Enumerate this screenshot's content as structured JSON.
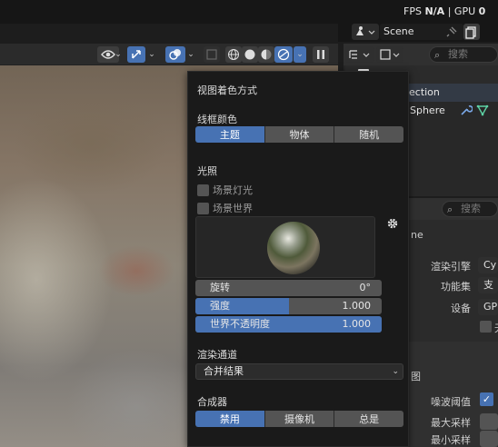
{
  "topbar": {
    "fps_label": "FPS",
    "fps_value": "N/A",
    "separator": "|",
    "gpu_label": "GPU",
    "gpu_value": "0"
  },
  "scene": {
    "name": "Scene"
  },
  "outliner": {
    "search_placeholder": "搜索",
    "collection_label": "ection",
    "object_label": "Sphere"
  },
  "popover": {
    "title": "视图着色方式",
    "wire_color": {
      "label": "线框颜色",
      "options": [
        "主题",
        "物体",
        "随机"
      ],
      "selected": 0
    },
    "lighting": {
      "label": "光照",
      "scene_lights_label": "场景灯光",
      "scene_world_label": "场景世界",
      "rotation": {
        "label": "旋转",
        "value": "0°",
        "fraction": 0.0
      },
      "strength": {
        "label": "强度",
        "value": "1.000",
        "fraction": 0.5
      },
      "world_opacity": {
        "label": "世界不透明度",
        "value": "1.000",
        "fraction": 1.0
      }
    },
    "render_pass": {
      "label": "渲染通道",
      "value": "合并结果"
    },
    "compositor": {
      "label": "合成器",
      "options": [
        "禁用",
        "摄像机",
        "总是"
      ],
      "selected": 0
    }
  },
  "properties": {
    "search_placeholder": "搜索",
    "scene_name_fragment": "ne",
    "render_engine_label": "渲染引擎",
    "render_engine_value": "Cy",
    "feature_set_label": "功能集",
    "feature_set_value": "支",
    "device_label": "设备",
    "device_value": "GP",
    "checkbox_fragment": "无",
    "section_fragment": "图",
    "noise_threshold_label": "噪波阈值",
    "max_samples_label": "最大采样",
    "min_samples_label": "最小采样"
  },
  "colors": {
    "accent": "#4772b3",
    "popover_bg": "#1a1a1a",
    "button_bg": "#545454"
  },
  "icons": [
    "eye-icon",
    "gizmo-icon",
    "overlay-icon",
    "xray-icon",
    "wireframe-icon",
    "solid-icon",
    "material-icon",
    "rendered-icon",
    "pause-icon",
    "gear-icon",
    "search-icon",
    "pin-icon",
    "copy-icon",
    "wrench-icon",
    "mesh-icon",
    "outliner-icon",
    "properties-icon"
  ]
}
